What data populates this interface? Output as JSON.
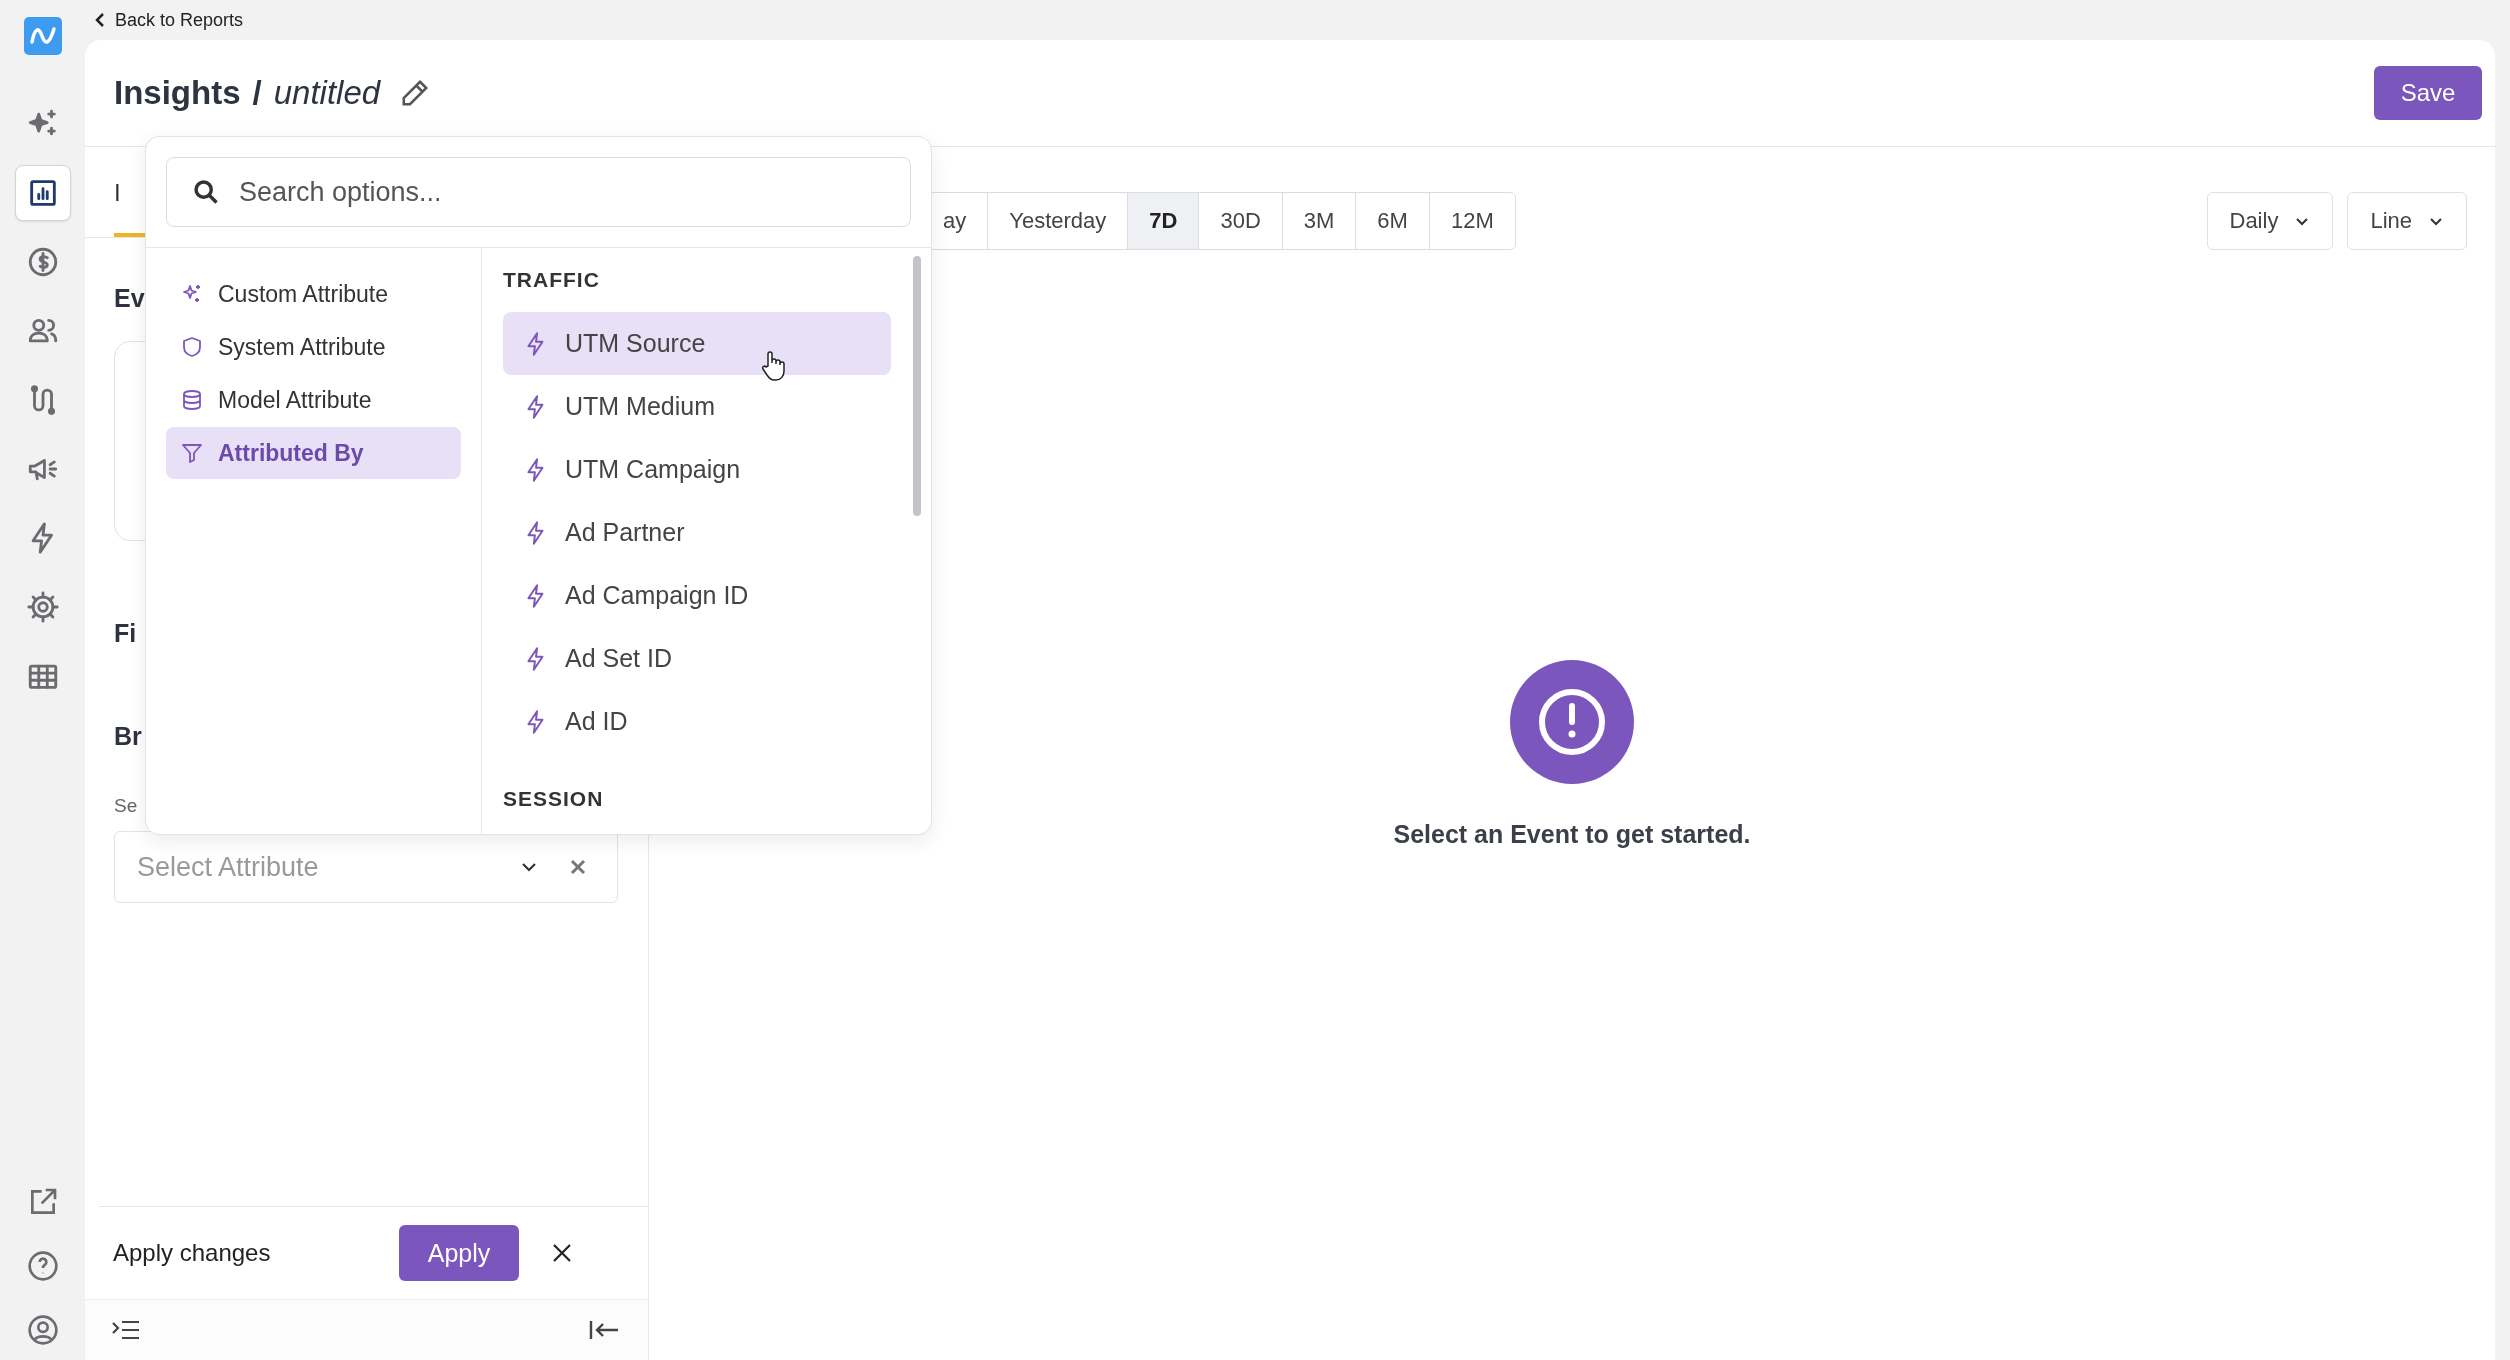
{
  "back_link": "Back to Reports",
  "nav_items": [
    {
      "selected": false
    },
    {
      "selected": true
    },
    {
      "selected": false
    },
    {
      "selected": false
    },
    {
      "selected": false
    },
    {
      "selected": false
    },
    {
      "selected": false
    },
    {
      "selected": false
    },
    {
      "selected": false
    }
  ],
  "header": {
    "title": "Insights",
    "separator": "/",
    "subtitle": "untitled",
    "save": "Save"
  },
  "left_panel": {
    "tab": {
      "label": "I",
      "selected": true
    },
    "section_1": "Ev",
    "section_2": "Fi",
    "section_3": "Br",
    "field_label": "Se",
    "select": {
      "placeholder": "Select Attribute"
    },
    "footer": {
      "label": "Apply changes",
      "apply": "Apply"
    }
  },
  "time_ranges": [
    {
      "label": "ay",
      "selected": false
    },
    {
      "label": "Yesterday",
      "selected": false
    },
    {
      "label": "7D",
      "selected": true
    },
    {
      "label": "30D",
      "selected": false
    },
    {
      "label": "3M",
      "selected": false
    },
    {
      "label": "6M",
      "selected": false
    },
    {
      "label": "12M",
      "selected": false
    }
  ],
  "interval": "Daily",
  "chart_type": "Line",
  "empty_state": "Select an Event to get started.",
  "dropdown": {
    "search_placeholder": "Search options...",
    "categories": [
      {
        "label": "Custom Attribute",
        "selected": false
      },
      {
        "label": "System Attribute",
        "selected": false
      },
      {
        "label": "Model Attribute",
        "selected": false
      },
      {
        "label": "Attributed By",
        "selected": true
      }
    ],
    "sections": [
      {
        "title": "TRAFFIC",
        "items": [
          {
            "label": "UTM Source",
            "selected": true
          },
          {
            "label": "UTM Medium",
            "selected": false
          },
          {
            "label": "UTM Campaign",
            "selected": false
          },
          {
            "label": "Ad Partner",
            "selected": false
          },
          {
            "label": "Ad Campaign ID",
            "selected": false
          },
          {
            "label": "Ad Set ID",
            "selected": false
          },
          {
            "label": "Ad ID",
            "selected": false
          }
        ]
      },
      {
        "title": "SESSION"
      }
    ]
  }
}
